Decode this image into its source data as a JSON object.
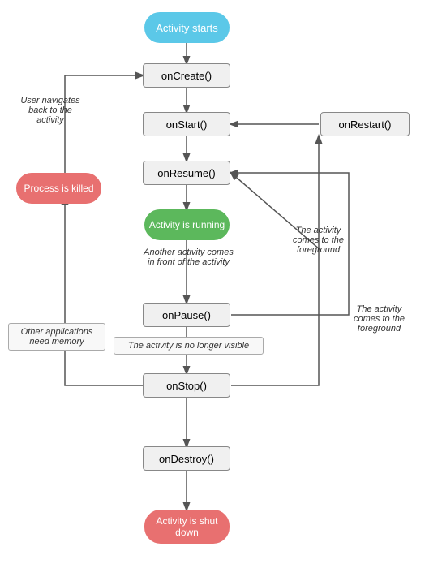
{
  "nodes": {
    "activity_starts": {
      "label": "Activity starts"
    },
    "onCreate": {
      "label": "onCreate()"
    },
    "onStart": {
      "label": "onStart()"
    },
    "onResume": {
      "label": "onResume()"
    },
    "activity_running": {
      "label": "Activity is running"
    },
    "onPause": {
      "label": "onPause()"
    },
    "onStop": {
      "label": "onStop()"
    },
    "onDestroy": {
      "label": "onDestroy()"
    },
    "activity_shutdown": {
      "label": "Activity is shut down"
    },
    "onRestart": {
      "label": "onRestart()"
    },
    "process_killed": {
      "label": "Process is killed"
    }
  },
  "labels": {
    "user_navigates": "User navigates\nback to the\nactivity",
    "another_activity": "Another activity comes\nin front of the activity",
    "activity_foreground1": "The activity\ncomes to the\nforeground",
    "activity_foreground2": "The activity\ncomes to the\nforeground",
    "no_longer_visible": "The activity is no longer visible",
    "other_apps": "Other applications\nneed memory"
  }
}
